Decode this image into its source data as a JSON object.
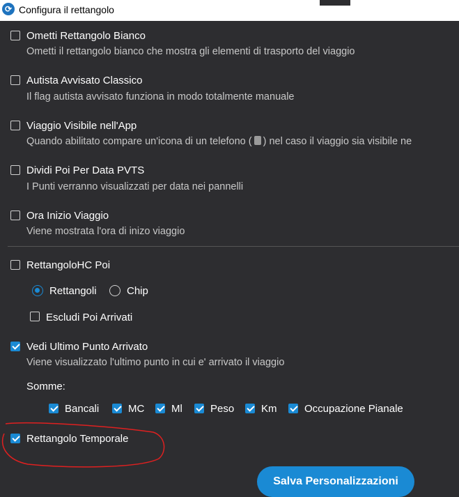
{
  "window": {
    "title": "Configura il rettangolo"
  },
  "options": [
    {
      "label": "Ometti Rettangolo Bianco",
      "desc": "Ometti il rettangolo bianco che mostra gli elementi di trasporto del viaggio",
      "checked": false
    },
    {
      "label": "Autista Avvisato Classico",
      "desc": "Il flag autista avvisato funziona in modo totalmente manuale",
      "checked": false
    },
    {
      "label": "Viaggio Visibile nell'App",
      "desc_before": "Quando abilitato compare un'icona di un telefono (",
      "desc_after": ") nel caso il viaggio sia visibile ne",
      "checked": false
    },
    {
      "label": "Dividi Poi Per Data PVTS",
      "desc": "I Punti verranno visualizzati per data nei pannelli",
      "checked": false
    },
    {
      "label": "Ora Inizio Viaggio",
      "desc": "Viene mostrata l'ora di inizo viaggio",
      "checked": false
    }
  ],
  "rettangolo_hc": {
    "label": "RettangoloHC Poi",
    "checked": false,
    "radio_options": [
      "Rettangoli",
      "Chip"
    ],
    "radio_selected": "Rettangoli",
    "escludi_label": "Escludi Poi Arrivati",
    "escludi_checked": false
  },
  "ultimo_punto": {
    "label": "Vedi Ultimo Punto Arrivato",
    "desc": "Viene visualizzato l'ultimo punto in cui e' arrivato il viaggio",
    "checked": true
  },
  "somme": {
    "label": "Somme:",
    "items": [
      "Bancali",
      "MC",
      "Ml",
      "Peso",
      "Km",
      "Occupazione Pianale"
    ]
  },
  "rettangolo_temporale": {
    "label": "Rettangolo Temporale",
    "checked": true
  },
  "save_button": "Salva Personalizzazioni",
  "colors": {
    "accent": "#1a8ad4",
    "background": "#2d2d30",
    "annotation": "#e02020"
  }
}
